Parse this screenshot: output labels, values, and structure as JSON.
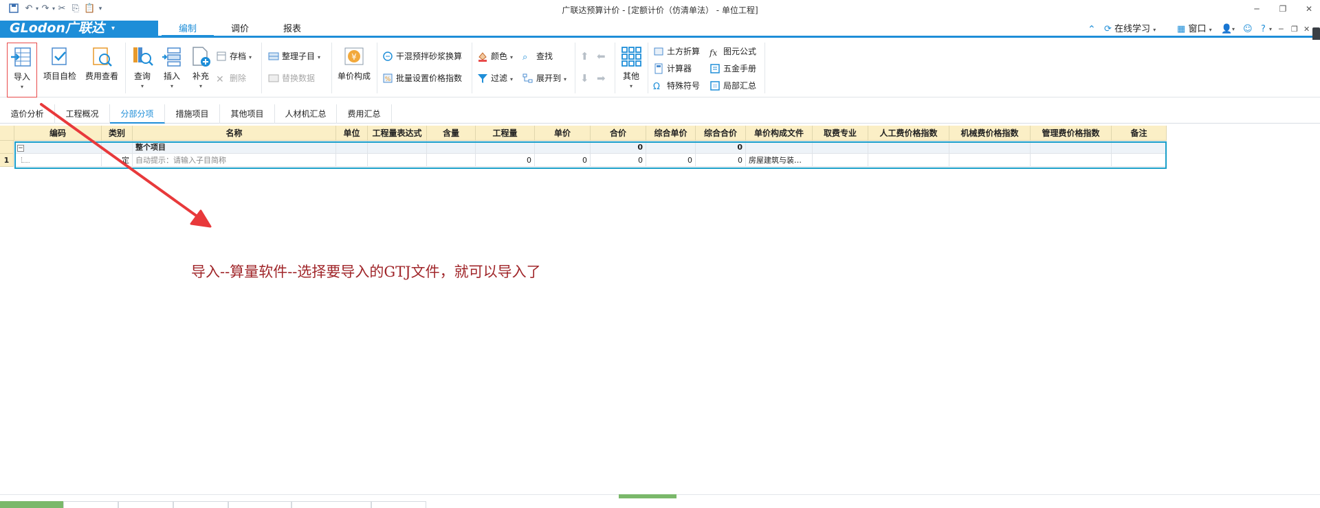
{
  "window": {
    "title": "广联达预算计价 - [定额计价（仿清单法） - 单位工程]"
  },
  "brand": {
    "logo": "GLodon广联达",
    "caret": "▾"
  },
  "menu": {
    "tabs": [
      "编制",
      "调价",
      "报表"
    ],
    "active_tab": "编制",
    "right": {
      "online_learning": "在线学习",
      "window": "窗口",
      "help": "?"
    }
  },
  "ribbon": {
    "big_buttons": [
      {
        "label": "导入",
        "icon": "import-icon",
        "dropdown": true,
        "highlighted": true
      },
      {
        "label": "项目自检",
        "icon": "project-check-icon"
      },
      {
        "label": "费用查看",
        "icon": "fee-view-icon"
      },
      {
        "label": "查询",
        "icon": "query-icon",
        "dropdown": true
      },
      {
        "label": "插入",
        "icon": "insert-icon",
        "dropdown": true
      },
      {
        "label": "补充",
        "icon": "supplement-icon",
        "dropdown": true
      },
      {
        "label": "单价构成",
        "icon": "unit-price-icon"
      },
      {
        "label": "其他",
        "icon": "other-grid-icon",
        "dropdown": true
      }
    ],
    "small_buttons": {
      "archive": "存档",
      "delete": "删除",
      "organize": "整理子目",
      "replace_data": "替换数据",
      "dry_mix": "干混预拌砂浆换算",
      "batch_price_index": "批量设置价格指数",
      "color": "颜色",
      "find": "查找",
      "filter": "过滤",
      "expand_to": "展开到",
      "earthwork": "土方折算",
      "calculator": "计算器",
      "special_symbol": "特殊符号",
      "element_formula": "图元公式",
      "hardware_manual": "五金手册",
      "partial_summary": "局部汇总"
    }
  },
  "sheet_tabs": [
    "造价分析",
    "工程概况",
    "分部分项",
    "措施项目",
    "其他项目",
    "人材机汇总",
    "费用汇总"
  ],
  "active_sheet_tab": "分部分项",
  "grid": {
    "columns": [
      "编码",
      "类别",
      "名称",
      "单位",
      "工程量表达式",
      "含量",
      "工程量",
      "单价",
      "合价",
      "综合单价",
      "综合合价",
      "单价构成文件",
      "取费专业",
      "人工费价格指数",
      "机械费价格指数",
      "管理费价格指数",
      "备注"
    ],
    "rows": [
      {
        "row_no": "",
        "toggle": "−",
        "code": "",
        "type": "",
        "name": "整个项目",
        "unit": "",
        "expr": "",
        "content": "",
        "qty": "",
        "unit_price": "",
        "total": "0",
        "comp_price": "",
        "comp_total": "0",
        "price_file": "",
        "fee_spec": "",
        "labor_idx": "",
        "machine_idx": "",
        "mgmt_idx": "",
        "note": ""
      },
      {
        "row_no": "1",
        "toggle": "",
        "code": "",
        "type": "定",
        "name": "自动提示：请输入子目简称",
        "unit": "",
        "expr": "",
        "content": "",
        "qty": "0",
        "unit_price": "0",
        "total": "0",
        "comp_price": "0",
        "comp_total": "0",
        "price_file": "房屋建筑与装…",
        "fee_spec": "",
        "labor_idx": "",
        "machine_idx": "",
        "mgmt_idx": "",
        "note": ""
      }
    ]
  },
  "annotation": {
    "text": "导入--算量软件--选择要导入的GTJ文件，就可以导入了",
    "color": "#a0262a",
    "arrow_color": "#e8393b"
  },
  "colors": {
    "accent": "#1e8ed8",
    "header_bg": "#fbefc6",
    "selection": "#1a9fc9"
  }
}
